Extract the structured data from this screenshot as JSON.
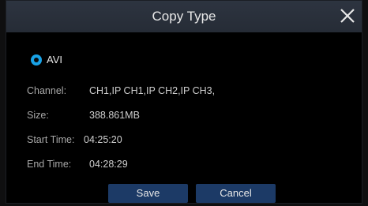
{
  "dialog": {
    "title": "Copy Type"
  },
  "copy_type": {
    "selected": "AVI"
  },
  "info": {
    "channel_label": "Channel:",
    "channel_value": "CH1,IP CH1,IP CH2,IP CH3,",
    "size_label": "Size:",
    "size_value": "388.861MB",
    "start_label": "Start Time:",
    "start_value": "04:25:20",
    "end_label": "End Time:",
    "end_value": "04:28:29"
  },
  "buttons": {
    "save": "Save",
    "cancel": "Cancel"
  },
  "colors": {
    "accent": "#19a2e6",
    "button": "#1c3a66",
    "titlebar": "#2a313c"
  }
}
